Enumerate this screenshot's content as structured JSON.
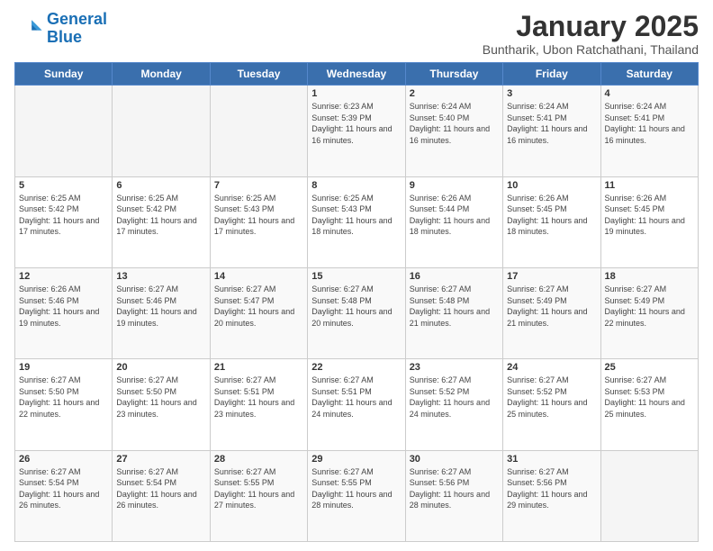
{
  "logo": {
    "line1": "General",
    "line2": "Blue"
  },
  "title": "January 2025",
  "subtitle": "Buntharik, Ubon Ratchathani, Thailand",
  "days_of_week": [
    "Sunday",
    "Monday",
    "Tuesday",
    "Wednesday",
    "Thursday",
    "Friday",
    "Saturday"
  ],
  "weeks": [
    [
      {
        "day": "",
        "sunrise": "",
        "sunset": "",
        "daylight": ""
      },
      {
        "day": "",
        "sunrise": "",
        "sunset": "",
        "daylight": ""
      },
      {
        "day": "",
        "sunrise": "",
        "sunset": "",
        "daylight": ""
      },
      {
        "day": "1",
        "sunrise": "6:23 AM",
        "sunset": "5:39 PM",
        "daylight": "11 hours and 16 minutes."
      },
      {
        "day": "2",
        "sunrise": "6:24 AM",
        "sunset": "5:40 PM",
        "daylight": "11 hours and 16 minutes."
      },
      {
        "day": "3",
        "sunrise": "6:24 AM",
        "sunset": "5:41 PM",
        "daylight": "11 hours and 16 minutes."
      },
      {
        "day": "4",
        "sunrise": "6:24 AM",
        "sunset": "5:41 PM",
        "daylight": "11 hours and 16 minutes."
      }
    ],
    [
      {
        "day": "5",
        "sunrise": "6:25 AM",
        "sunset": "5:42 PM",
        "daylight": "11 hours and 17 minutes."
      },
      {
        "day": "6",
        "sunrise": "6:25 AM",
        "sunset": "5:42 PM",
        "daylight": "11 hours and 17 minutes."
      },
      {
        "day": "7",
        "sunrise": "6:25 AM",
        "sunset": "5:43 PM",
        "daylight": "11 hours and 17 minutes."
      },
      {
        "day": "8",
        "sunrise": "6:25 AM",
        "sunset": "5:43 PM",
        "daylight": "11 hours and 18 minutes."
      },
      {
        "day": "9",
        "sunrise": "6:26 AM",
        "sunset": "5:44 PM",
        "daylight": "11 hours and 18 minutes."
      },
      {
        "day": "10",
        "sunrise": "6:26 AM",
        "sunset": "5:45 PM",
        "daylight": "11 hours and 18 minutes."
      },
      {
        "day": "11",
        "sunrise": "6:26 AM",
        "sunset": "5:45 PM",
        "daylight": "11 hours and 19 minutes."
      }
    ],
    [
      {
        "day": "12",
        "sunrise": "6:26 AM",
        "sunset": "5:46 PM",
        "daylight": "11 hours and 19 minutes."
      },
      {
        "day": "13",
        "sunrise": "6:27 AM",
        "sunset": "5:46 PM",
        "daylight": "11 hours and 19 minutes."
      },
      {
        "day": "14",
        "sunrise": "6:27 AM",
        "sunset": "5:47 PM",
        "daylight": "11 hours and 20 minutes."
      },
      {
        "day": "15",
        "sunrise": "6:27 AM",
        "sunset": "5:48 PM",
        "daylight": "11 hours and 20 minutes."
      },
      {
        "day": "16",
        "sunrise": "6:27 AM",
        "sunset": "5:48 PM",
        "daylight": "11 hours and 21 minutes."
      },
      {
        "day": "17",
        "sunrise": "6:27 AM",
        "sunset": "5:49 PM",
        "daylight": "11 hours and 21 minutes."
      },
      {
        "day": "18",
        "sunrise": "6:27 AM",
        "sunset": "5:49 PM",
        "daylight": "11 hours and 22 minutes."
      }
    ],
    [
      {
        "day": "19",
        "sunrise": "6:27 AM",
        "sunset": "5:50 PM",
        "daylight": "11 hours and 22 minutes."
      },
      {
        "day": "20",
        "sunrise": "6:27 AM",
        "sunset": "5:50 PM",
        "daylight": "11 hours and 23 minutes."
      },
      {
        "day": "21",
        "sunrise": "6:27 AM",
        "sunset": "5:51 PM",
        "daylight": "11 hours and 23 minutes."
      },
      {
        "day": "22",
        "sunrise": "6:27 AM",
        "sunset": "5:51 PM",
        "daylight": "11 hours and 24 minutes."
      },
      {
        "day": "23",
        "sunrise": "6:27 AM",
        "sunset": "5:52 PM",
        "daylight": "11 hours and 24 minutes."
      },
      {
        "day": "24",
        "sunrise": "6:27 AM",
        "sunset": "5:52 PM",
        "daylight": "11 hours and 25 minutes."
      },
      {
        "day": "25",
        "sunrise": "6:27 AM",
        "sunset": "5:53 PM",
        "daylight": "11 hours and 25 minutes."
      }
    ],
    [
      {
        "day": "26",
        "sunrise": "6:27 AM",
        "sunset": "5:54 PM",
        "daylight": "11 hours and 26 minutes."
      },
      {
        "day": "27",
        "sunrise": "6:27 AM",
        "sunset": "5:54 PM",
        "daylight": "11 hours and 26 minutes."
      },
      {
        "day": "28",
        "sunrise": "6:27 AM",
        "sunset": "5:55 PM",
        "daylight": "11 hours and 27 minutes."
      },
      {
        "day": "29",
        "sunrise": "6:27 AM",
        "sunset": "5:55 PM",
        "daylight": "11 hours and 28 minutes."
      },
      {
        "day": "30",
        "sunrise": "6:27 AM",
        "sunset": "5:56 PM",
        "daylight": "11 hours and 28 minutes."
      },
      {
        "day": "31",
        "sunrise": "6:27 AM",
        "sunset": "5:56 PM",
        "daylight": "11 hours and 29 minutes."
      },
      {
        "day": "",
        "sunrise": "",
        "sunset": "",
        "daylight": ""
      }
    ]
  ],
  "labels": {
    "sunrise": "Sunrise:",
    "sunset": "Sunset:",
    "daylight": "Daylight:"
  }
}
